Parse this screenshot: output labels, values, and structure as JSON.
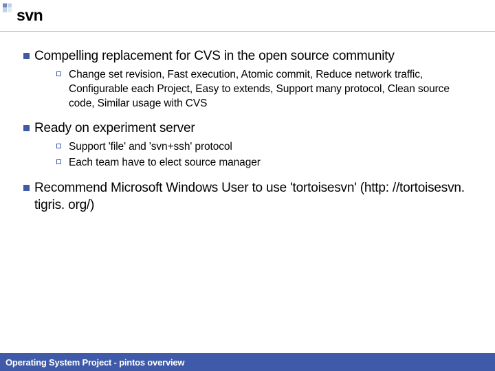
{
  "slide": {
    "title": "svn",
    "bullets": [
      {
        "text": "Compelling replacement for CVS in the open source community",
        "sub": [
          "Change set revision, Fast execution, Atomic commit, Reduce network traffic, Configurable each Project, Easy to extends, Support many protocol, Clean source code, Similar usage with CVS"
        ]
      },
      {
        "text": "Ready on experiment server",
        "sub": [
          "Support 'file' and 'svn+ssh' protocol",
          "Each team have to elect source manager"
        ]
      },
      {
        "text": "Recommend Microsoft Windows User to use 'tortoisesvn' (http: //tortoisesvn. tigris. org/)",
        "sub": []
      }
    ],
    "footer": "Operating System Project - pintos overview"
  }
}
